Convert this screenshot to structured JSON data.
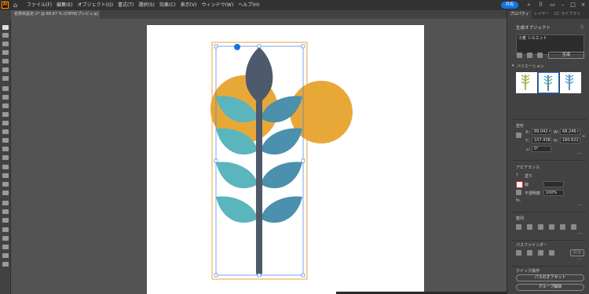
{
  "app": {
    "logo": "Ai",
    "share_label": "共有"
  },
  "menus": [
    "ファイル(F)",
    "編集(E)",
    "オブジェクト(O)",
    "書式(T)",
    "選択(S)",
    "効果(C)",
    "表示(V)",
    "ウィンドウ(W)",
    "ヘルプ(H)"
  ],
  "document_tab": {
    "title": "名称未設定-2* @ 88.67 % (CMYK/プレビュー)",
    "close": "×"
  },
  "panel": {
    "tabs": [
      "プロパティ",
      "レイヤー",
      "CC ライブラリ"
    ],
    "generative": {
      "title": "生成オブジェクト",
      "prompt_label": "小麦 シルエット",
      "generate_label": "生成",
      "variations_label": "バリエーション"
    },
    "transform": {
      "title": "変形",
      "x_label": "X：",
      "x_value": "89.042 r",
      "y_label": "Y：",
      "y_value": "107.438",
      "w_label": "W：",
      "w_value": "68.246 r",
      "h_label": "H：",
      "h_value": "180.622",
      "angle_label": "⊿：",
      "angle_value": "0°"
    },
    "appearance": {
      "title": "アピアランス",
      "fill_label": "塗り",
      "stroke_label": "線",
      "opacity_label": "不透明度",
      "opacity_value": "100%",
      "fx_label": "fx."
    },
    "align": {
      "title": "整列"
    },
    "pathfinder": {
      "title": "パスファインダー",
      "expand_label": "拡張"
    },
    "quick_actions": {
      "title": "クイック操作",
      "offset_label": "パスのオフセット",
      "ungroup_label": "グループ解除"
    }
  },
  "colors": {
    "accent": "#1473e6",
    "orange": "#E8A838",
    "teal": "#5BB5BD",
    "blue": "#4B90AC",
    "stem": "#4E5A6B"
  },
  "icons": [
    "home-icon",
    "search-icon",
    "grid-icon",
    "window-icon",
    "info-icon",
    "chevron-down-icon",
    "link-icon",
    "ellipsis-icon"
  ]
}
